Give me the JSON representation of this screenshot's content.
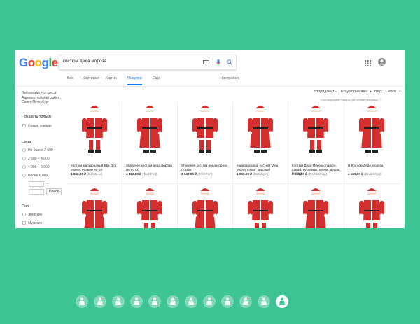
{
  "logo": [
    "G",
    "o",
    "o",
    "g",
    "l",
    "e"
  ],
  "logo_colors": [
    "#4285f4",
    "#ea4335",
    "#fbbc05",
    "#4285f4",
    "#34a853",
    "#ea4335"
  ],
  "search": {
    "query": "костюм деда мороза"
  },
  "icons": {
    "keyboard": "keyboard-icon",
    "mic": "mic-icon",
    "search": "search-icon",
    "apps": "apps-grid-icon",
    "account": "account-icon"
  },
  "tabs": [
    {
      "label": "Все",
      "active": false
    },
    {
      "label": "Картинки",
      "active": false
    },
    {
      "label": "Карты",
      "active": false
    },
    {
      "label": "Покупки",
      "active": true
    },
    {
      "label": "Ещё",
      "active": false
    },
    {
      "label": "Настройки",
      "active": false
    }
  ],
  "sidebar": {
    "location": "Вы находитесь здесь: Адмиралтейский район, Санкт-Петербург",
    "show_only_title": "Показать только",
    "new_items": "Новые товары",
    "price_title": "Цена",
    "price_options": [
      "Не более 2 500",
      "2 500 – 4 000",
      "4 000 – 6 000",
      "Более 6 000"
    ],
    "dash": "–",
    "search_btn": "Поиск",
    "gender_title": "Пол",
    "gender_options": [
      "Женские",
      "Мужские"
    ]
  },
  "sort": {
    "label": "Упорядочить:",
    "value": "По умолчанию",
    "view_label": "Вид:",
    "view_value": "Сетка"
  },
  "sponsored": "Спонсируемые товары (на основе рекламы)",
  "products": [
    {
      "title": "Костюм маскарадный Ева Дед Мороз, Размер 48-54",
      "price": "1 592,00 ₽",
      "shop": "(OZON.ru)"
    },
    {
      "title": "Showmen костюм деда мороза (E70173)",
      "price": "4 302,00 ₽",
      "shop": "(TechPort)"
    },
    {
      "title": "Showmen костюм деда мороза (E3402)",
      "price": "3 647,00 ₽",
      "shop": "(TechPort)"
    },
    {
      "title": "Карнавальный костюм \"Дед Мороз плюш\" красный",
      "price": "1 992,00 ₽",
      "shop": "(Babyby.ru)"
    },
    {
      "title": "Костюм Деда Мороза: пальто, шапка, рукавицы, кушак, мешок, борода",
      "price": "6 860,00 ₽",
      "shop": "(RamkiShop)"
    },
    {
      "title": "Н.Костюм Деда Мороза",
      "price": "4 503,00 ₽",
      "shop": "(BookShop)"
    }
  ],
  "second_row_count": 6,
  "slide_count": 12,
  "active_slide": 11,
  "accent": "#1a73e8",
  "suit_color": "#d32f2f",
  "background": "#3ec494"
}
